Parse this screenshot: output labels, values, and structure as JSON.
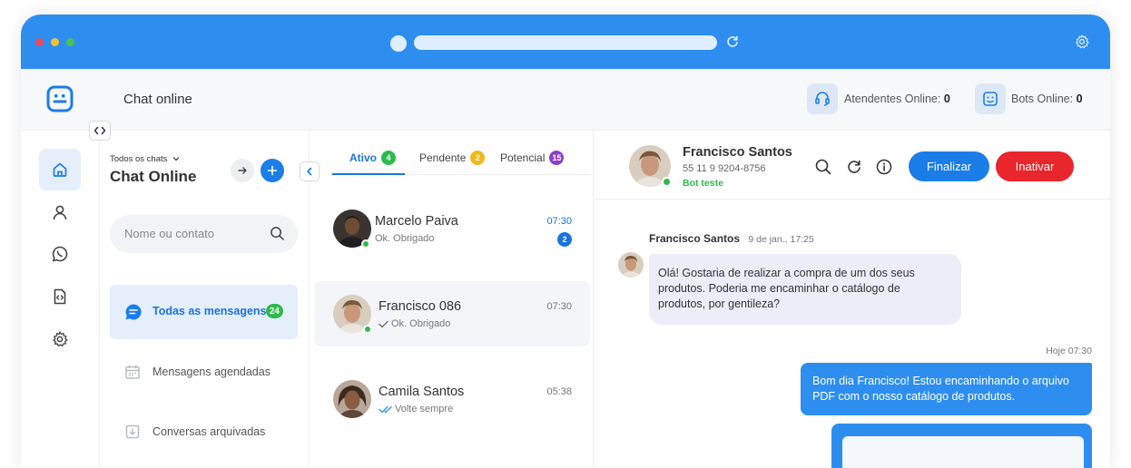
{
  "app": {
    "page_title": "Chat online",
    "atendentes_label": "Atendentes Online:",
    "atendentes_count": "0",
    "bots_label": "Bots Online:",
    "bots_count": "0"
  },
  "colors": {
    "browser_bar": "#2e8ef0",
    "accent": "#1b73db",
    "online": "#2dbb4e",
    "danger": "#e8262c",
    "pending": "#f2b91c",
    "potential": "#8b3fc7"
  },
  "sidebar": {
    "items": [
      {
        "icon": "home-icon",
        "active": true
      },
      {
        "icon": "user-icon",
        "active": false
      },
      {
        "icon": "whatsapp-icon",
        "active": false
      },
      {
        "icon": "code-file-icon",
        "active": false
      },
      {
        "icon": "gear-icon",
        "active": false
      }
    ]
  },
  "categories": {
    "filter_label": "Todos os chats",
    "title": "Chat Online",
    "search_placeholder": "Nome ou contato",
    "items": [
      {
        "label": "Todas as mensagens",
        "count": "24",
        "active": true
      },
      {
        "label": "Mensagens agendadas",
        "active": false
      },
      {
        "label": "Conversas arquivadas",
        "active": false
      }
    ]
  },
  "chat_list": {
    "tabs": [
      {
        "label": "Ativo",
        "count": "4"
      },
      {
        "label": "Pendente",
        "count": "2"
      },
      {
        "label": "Potencial",
        "count": "15"
      }
    ],
    "chats": [
      {
        "name": "Marcelo Paiva",
        "preview": "Ok. Obrigado",
        "time": "07:30",
        "unread": "2"
      },
      {
        "name": "Francisco 086",
        "preview": "Ok. Obrigado",
        "time": "07:30"
      },
      {
        "name": "Camila Santos",
        "preview": "Volte sempre",
        "time": "05:38"
      }
    ]
  },
  "conversation": {
    "contact_name": "Francisco Santos",
    "contact_phone": "55 11 9 9204-8756",
    "bot_label": "Bot teste",
    "finalizar_label": "Finalizar",
    "inativar_label": "Inativar",
    "incoming": {
      "sender": "Francisco Santos",
      "date": "9 de jan., 17:25",
      "text": "Olá! Gostaria de realizar a compra de um dos seus produtos. Poderia me encaminhar o catálogo de produtos, por gentileza?"
    },
    "outgoing": {
      "time": "Hoje 07:30",
      "text": "Bom dia Francisco! Estou encaminhando o arquivo PDF com o nosso catálogo de produtos."
    }
  }
}
